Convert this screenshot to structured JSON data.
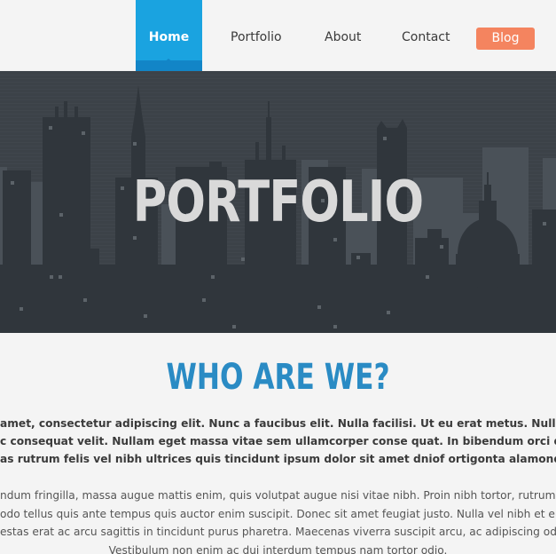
{
  "nav": {
    "home": "Home",
    "portfolio": "Portfolio",
    "about": "About",
    "contact": "Contact",
    "blog": "Blog"
  },
  "hero": {
    "title": "PORTFOLIO"
  },
  "section": {
    "title": "WHO ARE WE?"
  },
  "paragraphs": {
    "intro_lines": [
      "amet, consectetur adipiscing elit. Nunc a faucibus elit. Nulla facilisi. Ut eu erat metus. Nulla diam venen",
      "c consequat velit. Nullam eget massa vitae sem ullamcorper conse quat. In bibendum orci quis magna",
      "as rutrum felis vel nibh ultrices quis tincidunt ipsum dolor sit amet dniof ortigonta alamond druntilorte"
    ],
    "body_lines": [
      "ndum fringilla, massa augue mattis enim, quis volutpat augue nisi vitae nibh. Proin nibh tortor, rutrum luctu",
      "odo tellus quis ante tempus quis auctor enim suscipit. Donec sit amet feugiat justo. Nulla vel nibh et erat co",
      "estas erat ac arcu sagittis in tincidunt purus pharetra. Maecenas viverra suscipit arcu, ac adipiscing odio veh",
      "Vestibulum non enim ac dui interdum tempus nam tortor odio."
    ]
  },
  "colors": {
    "nav_active": "#1aa3e0",
    "blog_button": "#f4845f",
    "heading": "#2a8bc4",
    "hero_bg": "#3c4248"
  }
}
